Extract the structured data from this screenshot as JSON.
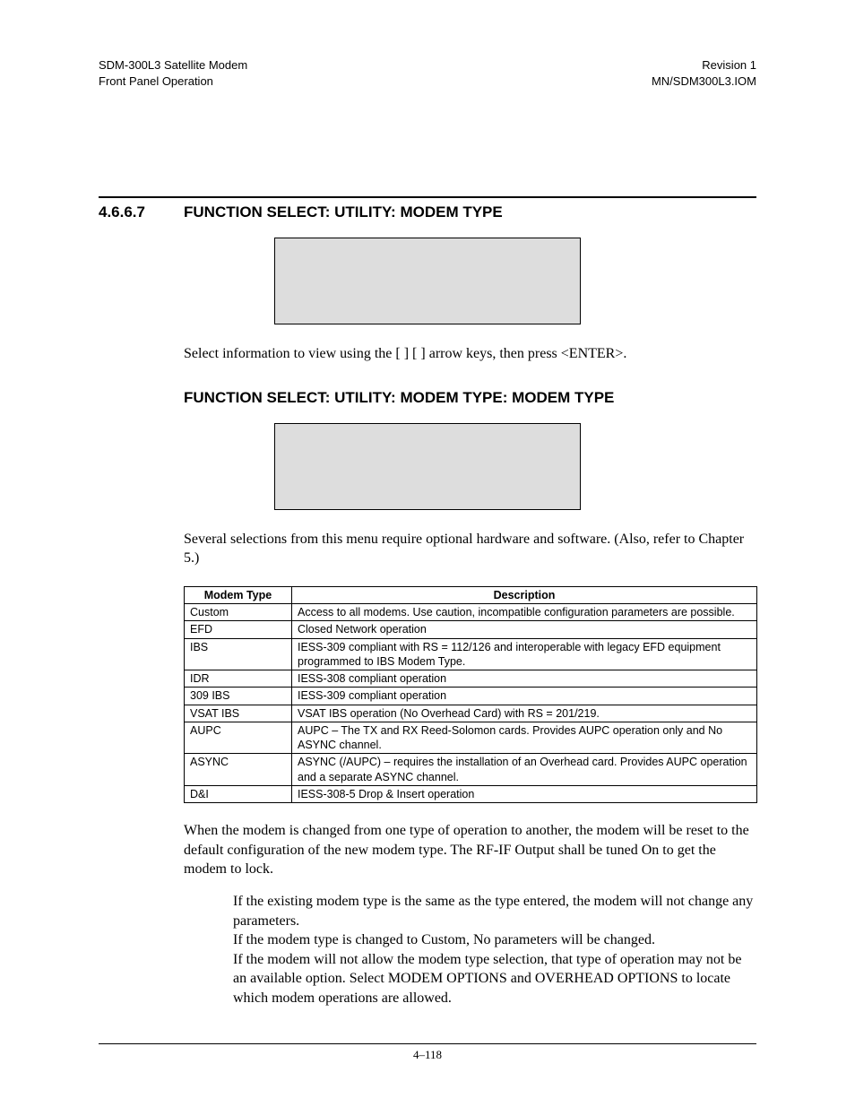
{
  "header": {
    "left_line1": "SDM-300L3 Satellite Modem",
    "left_line2": "Front Panel Operation",
    "right_line1": "Revision 1",
    "right_line2": "MN/SDM300L3.IOM"
  },
  "section": {
    "number": "4.6.6.7",
    "title": "FUNCTION SELECT: UTILITY: MODEM TYPE"
  },
  "instruction1": "Select information to view using the [   ] [   ] arrow keys, then press <ENTER>.",
  "subheading": "FUNCTION SELECT: UTILITY: MODEM TYPE: MODEM TYPE",
  "instruction2": "Several selections from this menu require optional hardware and software. (Also, refer to Chapter 5.)",
  "table": {
    "headers": [
      "Modem Type",
      "Description"
    ],
    "rows": [
      {
        "type": "Custom",
        "desc": "Access to all modems. Use caution, incompatible configuration parameters are possible."
      },
      {
        "type": "EFD",
        "desc": "Closed Network operation"
      },
      {
        "type": "IBS",
        "desc": "IESS-309 compliant with RS = 112/126 and interoperable with legacy EFD equipment programmed to IBS Modem Type."
      },
      {
        "type": "IDR",
        "desc": "IESS-308 compliant operation"
      },
      {
        "type": "309 IBS",
        "desc": "IESS-309 compliant operation"
      },
      {
        "type": "VSAT IBS",
        "desc": "VSAT IBS operation (No Overhead Card) with RS = 201/219."
      },
      {
        "type": "AUPC",
        "desc": "AUPC – The TX and RX Reed-Solomon cards. Provides AUPC operation only and No ASYNC channel."
      },
      {
        "type": "ASYNC",
        "desc": "ASYNC (/AUPC) – requires the installation of an Overhead card. Provides AUPC operation and a separate ASYNC channel."
      },
      {
        "type": "D&I",
        "desc": "IESS-308-5 Drop & Insert operation"
      }
    ]
  },
  "para_after_table": "When the modem is changed from one type of operation to another, the modem will be reset to the default configuration of the new modem type. The RF-IF Output shall be tuned On to get the modem to lock.",
  "notes": {
    "n1": "If the existing modem type is the same as the type entered, the modem will not change any parameters.",
    "n2": "If the modem type is changed to Custom, No parameters will be changed.",
    "n3": "If the modem will not allow the modem type selection, that type of operation may not be an available option. Select MODEM OPTIONS and OVERHEAD OPTIONS to locate which modem operations are allowed."
  },
  "footer": "4–118"
}
